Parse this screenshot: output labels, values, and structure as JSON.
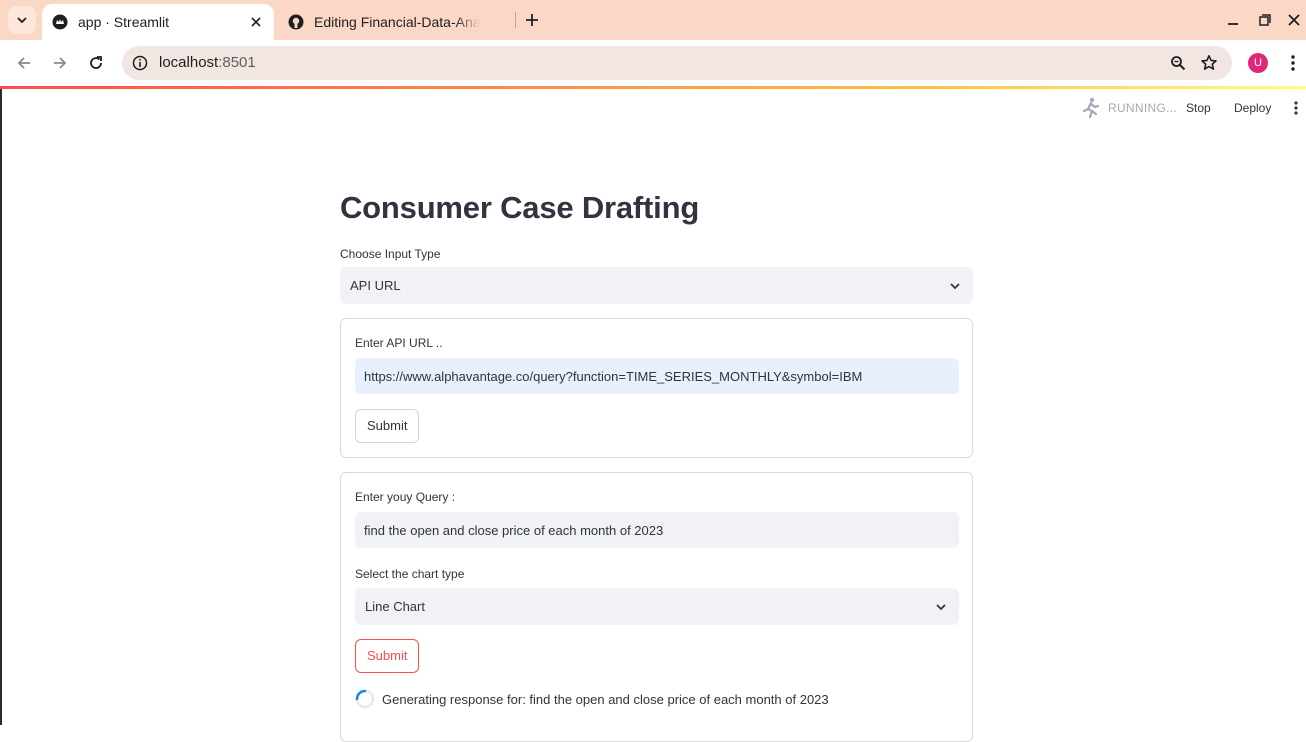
{
  "browser": {
    "tabs": [
      {
        "title": "app · Streamlit",
        "active": true
      },
      {
        "title": "Editing Financial-Data-Analysis",
        "active": false
      }
    ],
    "url_host": "localhost",
    "url_port": ":8501",
    "profile_initial": "U"
  },
  "streamlit_header": {
    "status": "RUNNING...",
    "stop_label": "Stop",
    "deploy_label": "Deploy"
  },
  "page": {
    "title": "Consumer Case Drafting",
    "input_type": {
      "label": "Choose Input Type",
      "selected": "API URL"
    },
    "api_form": {
      "label": "Enter API URL ..",
      "value": "https://www.alphavantage.co/query?function=TIME_SERIES_MONTHLY&symbol=IBM",
      "submit_label": "Submit"
    },
    "query_form": {
      "label": "Enter youy Query :",
      "value": "find the open and close price of each month of 2023",
      "chart_label": "Select the chart type",
      "chart_selected": "Line Chart",
      "submit_label": "Submit",
      "status_text": "Generating response for: find the open and close price of each month of 2023"
    }
  },
  "colors": {
    "tabbar": "#fbd8c6",
    "accent": "#ff4b4b",
    "input_bg": "#f0f2f6",
    "focused_input_bg": "#e8f0fe",
    "avatar": "#e0287a"
  }
}
